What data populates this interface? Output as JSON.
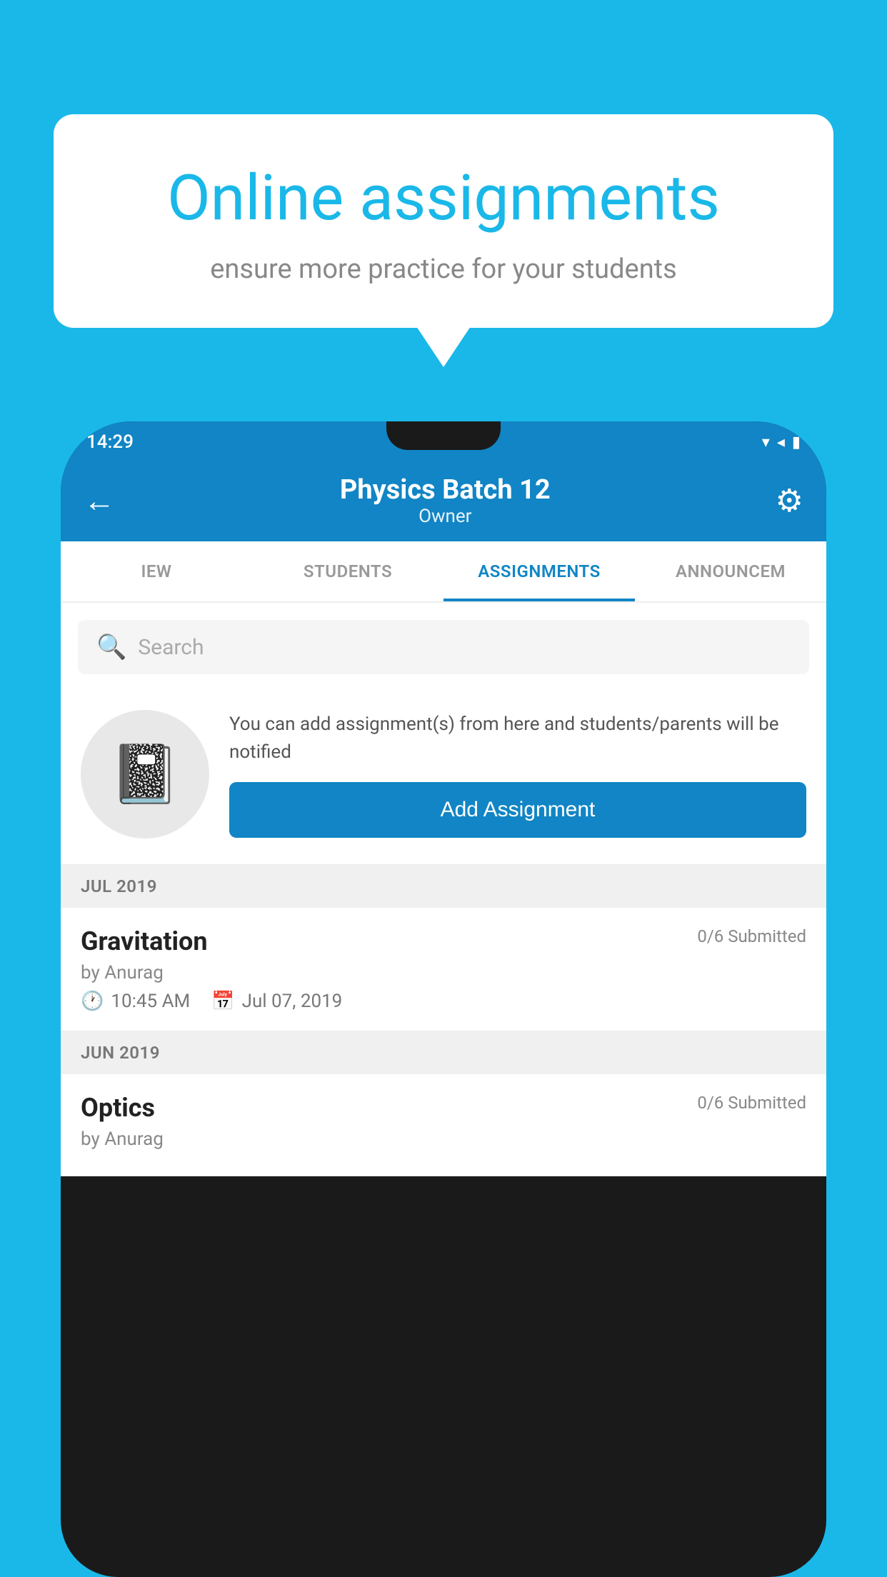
{
  "background_color": "#1ab8e8",
  "speech_bubble": {
    "title": "Online assignments",
    "subtitle": "ensure more practice for your students"
  },
  "phone": {
    "status_bar": {
      "time": "14:29",
      "icons": [
        "▾",
        "◂▸",
        "▮"
      ]
    },
    "header": {
      "title": "Physics Batch 12",
      "subtitle": "Owner",
      "back_label": "←",
      "settings_label": "⚙"
    },
    "tabs": [
      {
        "label": "IEW",
        "active": false
      },
      {
        "label": "STUDENTS",
        "active": false
      },
      {
        "label": "ASSIGNMENTS",
        "active": true
      },
      {
        "label": "ANNOUNCEM",
        "active": false
      }
    ],
    "search": {
      "placeholder": "Search"
    },
    "promo": {
      "description": "You can add assignment(s) from here and students/parents will be notified",
      "button_label": "Add Assignment"
    },
    "sections": [
      {
        "label": "JUL 2019",
        "assignments": [
          {
            "name": "Gravitation",
            "submitted": "0/6 Submitted",
            "by": "by Anurag",
            "time": "10:45 AM",
            "date": "Jul 07, 2019"
          }
        ]
      },
      {
        "label": "JUN 2019",
        "assignments": [
          {
            "name": "Optics",
            "submitted": "0/6 Submitted",
            "by": "by Anurag",
            "time": "",
            "date": ""
          }
        ]
      }
    ]
  }
}
